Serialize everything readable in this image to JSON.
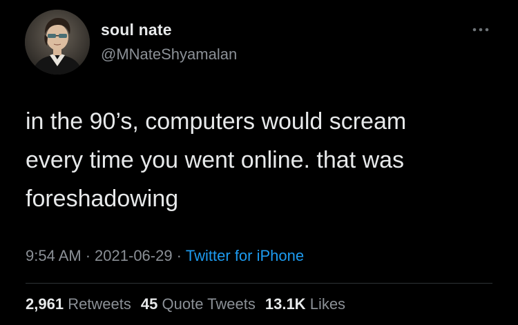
{
  "user": {
    "display_name": "soul nate",
    "handle": "@MNateShyamalan",
    "avatar_icon": "portrait-avatar"
  },
  "tweet": {
    "text": "in the 90’s, computers would scream\nevery time you went online. that was\nforeshadowing",
    "time": "9:54 AM",
    "date": "2021-06-29",
    "separator": "·",
    "source": "Twitter for iPhone"
  },
  "stats": {
    "retweets_count": "2,961",
    "retweets_label": "Retweets",
    "quote_tweets_count": "45",
    "quote_tweets_label": "Quote Tweets",
    "likes_count": "13.1K",
    "likes_label": "Likes"
  },
  "colors": {
    "background": "#000000",
    "text_primary": "#e7e9ea",
    "text_secondary": "#8b9096",
    "link": "#1d9bf0"
  }
}
